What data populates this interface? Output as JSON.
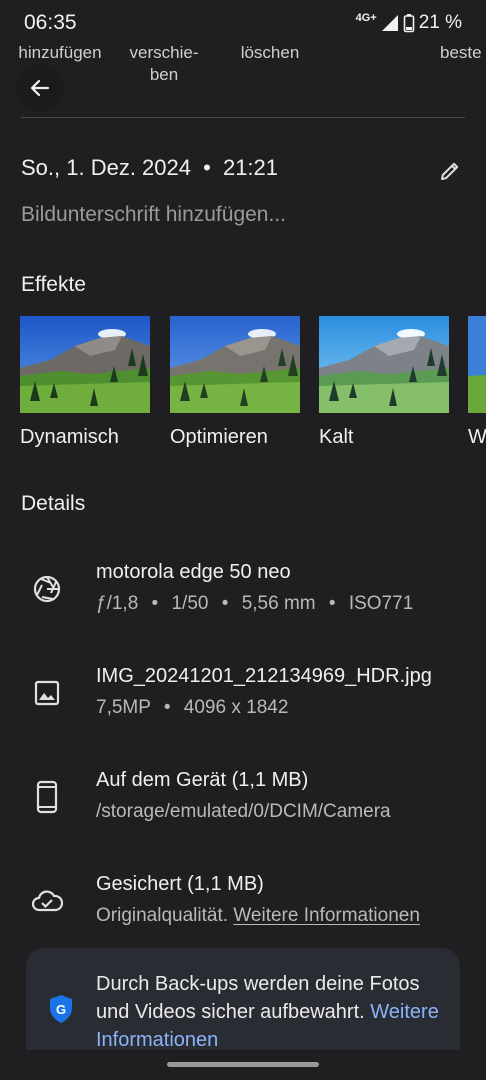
{
  "status_bar": {
    "time": "06:35",
    "network": "4G+",
    "battery": "21 %"
  },
  "top_actions": {
    "add": "hinzufügen",
    "move_line1": "verschie-",
    "move_line2": "ben",
    "delete": "löschen",
    "edit": "beste"
  },
  "date": {
    "day": "So., 1. Dez. 2024",
    "separator": "•",
    "time": "21:21"
  },
  "caption_placeholder": "Bildunterschrift hinzufügen...",
  "effects": {
    "title": "Effekte",
    "items": [
      {
        "label": "Dynamisch",
        "style": "dynamic"
      },
      {
        "label": "Optimieren",
        "style": "enhance"
      },
      {
        "label": "Kalt",
        "style": "cool"
      },
      {
        "label": "W",
        "style": "warm"
      }
    ]
  },
  "details": {
    "title": "Details",
    "camera": {
      "icon": "aperture-icon",
      "title": "motorola edge 50 neo",
      "aperture": "ƒ/1,8",
      "shutter": "1/50",
      "focal": "5,56 mm",
      "iso": "ISO771",
      "sep": "•"
    },
    "file": {
      "icon": "image-icon",
      "title": "IMG_20241201_212134969_HDR.jpg",
      "megapixels": "7,5MP",
      "resolution": "4096 x 1842",
      "sep": "•"
    },
    "device": {
      "icon": "phone-icon",
      "title": "Auf dem Gerät (1,1 MB)",
      "path": "/storage/emulated/0/DCIM/Camera"
    },
    "backup": {
      "icon": "cloud-done-icon",
      "title": "Gesichert (1,1 MB)",
      "quality": "Originalqualität.",
      "link": "Weitere Informationen"
    }
  },
  "banner": {
    "icon": "shield-google-icon",
    "text": "Durch Back-ups werden deine Fotos und Videos sicher aufbewahrt.",
    "link": "Weitere Informationen"
  },
  "colors": {
    "background": "#1f1f22",
    "link_blue": "#8ab4f8",
    "shield_blue": "#1a73e8"
  }
}
